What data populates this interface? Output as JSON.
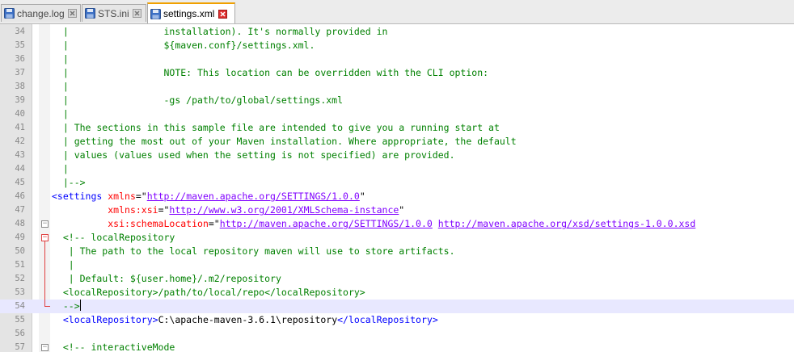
{
  "tabs": [
    {
      "label": "change.log",
      "icon": "floppy-disk-icon",
      "close_icon": "close-icon",
      "active": false
    },
    {
      "label": "STS.ini",
      "icon": "floppy-disk-icon",
      "close_icon": "close-icon",
      "active": false
    },
    {
      "label": "settings.xml",
      "icon": "floppy-disk-icon",
      "close_icon": "close-icon",
      "active": true
    }
  ],
  "editor": {
    "current_line": "54",
    "lines": [
      {
        "n": "34",
        "segs": [
          {
            "k": "c",
            "t": "  |                 installation). It's normally provided in"
          }
        ]
      },
      {
        "n": "35",
        "segs": [
          {
            "k": "c",
            "t": "  |                 ${maven.conf}/settings.xml."
          }
        ]
      },
      {
        "n": "36",
        "segs": [
          {
            "k": "c",
            "t": "  |"
          }
        ]
      },
      {
        "n": "37",
        "segs": [
          {
            "k": "c",
            "t": "  |                 NOTE: This location can be overridden with the CLI option:"
          }
        ]
      },
      {
        "n": "38",
        "segs": [
          {
            "k": "c",
            "t": "  |"
          }
        ]
      },
      {
        "n": "39",
        "segs": [
          {
            "k": "c",
            "t": "  |                 -gs /path/to/global/settings.xml"
          }
        ]
      },
      {
        "n": "40",
        "segs": [
          {
            "k": "c",
            "t": "  |"
          }
        ]
      },
      {
        "n": "41",
        "segs": [
          {
            "k": "c",
            "t": "  | The sections in this sample file are intended to give you a running start at"
          }
        ]
      },
      {
        "n": "42",
        "segs": [
          {
            "k": "c",
            "t": "  | getting the most out of your Maven installation. Where appropriate, the default"
          }
        ]
      },
      {
        "n": "43",
        "segs": [
          {
            "k": "c",
            "t": "  | values (values used when the setting is not specified) are provided."
          }
        ]
      },
      {
        "n": "44",
        "segs": [
          {
            "k": "c",
            "t": "  |"
          }
        ]
      },
      {
        "n": "45",
        "segs": [
          {
            "k": "c",
            "t": "  |-->"
          }
        ]
      },
      {
        "n": "46",
        "segs": [
          {
            "k": "t",
            "t": "<settings "
          },
          {
            "k": "a",
            "t": "xmlns"
          },
          {
            "k": "p",
            "t": "=\""
          },
          {
            "k": "s",
            "t": "http://maven.apache.org/SETTINGS/1.0.0"
          },
          {
            "k": "p",
            "t": "\""
          }
        ]
      },
      {
        "n": "47",
        "segs": [
          {
            "k": "p",
            "t": "          "
          },
          {
            "k": "a",
            "t": "xmlns:xsi"
          },
          {
            "k": "p",
            "t": "=\""
          },
          {
            "k": "s",
            "t": "http://www.w3.org/2001/XMLSchema-instance"
          },
          {
            "k": "p",
            "t": "\""
          }
        ]
      },
      {
        "n": "48",
        "segs": [
          {
            "k": "p",
            "t": "          "
          },
          {
            "k": "a",
            "t": "xsi:schemaLocation"
          },
          {
            "k": "p",
            "t": "=\""
          },
          {
            "k": "s",
            "t": "http://maven.apache.org/SETTINGS/1.0.0"
          },
          {
            "k": "p",
            "t": " "
          },
          {
            "k": "s",
            "t": "http://maven.apache.org/xsd/settings-1.0.0.xsd"
          }
        ]
      },
      {
        "n": "49",
        "segs": [
          {
            "k": "p",
            "t": "  "
          },
          {
            "k": "c",
            "t": "<!-- localRepository"
          }
        ]
      },
      {
        "n": "50",
        "segs": [
          {
            "k": "c",
            "t": "   | The path to the local repository maven will use to store artifacts."
          }
        ]
      },
      {
        "n": "51",
        "segs": [
          {
            "k": "c",
            "t": "   |"
          }
        ]
      },
      {
        "n": "52",
        "segs": [
          {
            "k": "c",
            "t": "   | Default: ${user.home}/.m2/repository"
          }
        ]
      },
      {
        "n": "53",
        "segs": [
          {
            "k": "c",
            "t": "  <localRepository>/path/to/local/repo</localRepository>"
          }
        ]
      },
      {
        "n": "54",
        "segs": [
          {
            "k": "c",
            "t": "  -->"
          }
        ]
      },
      {
        "n": "55",
        "segs": [
          {
            "k": "p",
            "t": "  "
          },
          {
            "k": "t",
            "t": "<localRepository>"
          },
          {
            "k": "p",
            "t": "C:\\apache-maven-3.6.1\\repository"
          },
          {
            "k": "t",
            "t": "</localRepository>"
          }
        ]
      },
      {
        "n": "56",
        "segs": [
          {
            "k": "p",
            "t": ""
          }
        ]
      },
      {
        "n": "57",
        "segs": [
          {
            "k": "p",
            "t": "  "
          },
          {
            "k": "c",
            "t": "<!-- interactiveMode"
          }
        ]
      }
    ]
  },
  "colors": {
    "comment": "#008000",
    "tag": "#0000ff",
    "attribute": "#ff0000",
    "string": "#8000ff",
    "fold_marker": "#e04040",
    "current_line_bg": "#e8e8ff"
  }
}
